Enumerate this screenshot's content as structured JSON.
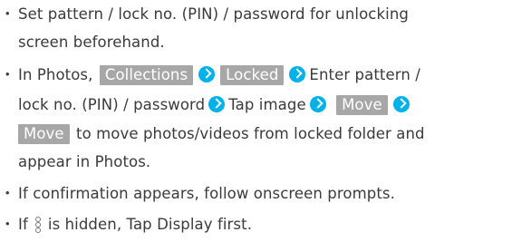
{
  "bullets": [
    {
      "marker": "・",
      "line1": "Set pattern / lock no. (PIN) / password for unlocking",
      "line2": "screen beforehand."
    },
    {
      "marker": "・",
      "prefix": "In Photos,",
      "pill_collections": "Collections",
      "pill_locked": "Locked",
      "text_after_locked": "Enter pattern /",
      "text_line2": "lock no. (PIN) / password",
      "text_tap_image": "Tap image",
      "pill_move_1": "Move",
      "pill_move_2": "Move",
      "text_line3_after": "to move photos/videos from locked folder and",
      "text_line4": "appear in Photos."
    },
    {
      "marker": "・",
      "text": "If confirmation appears, follow onscreen prompts."
    },
    {
      "marker": "・",
      "text_before_icon": "If",
      "icon": "more-vertical-icon",
      "text_after_icon": "is hidden, Tap Display first."
    }
  ],
  "colors": {
    "pill_bg": "#a7a7a7",
    "arrow_bg": "#00b1ea",
    "text": "#3a3a3a"
  }
}
